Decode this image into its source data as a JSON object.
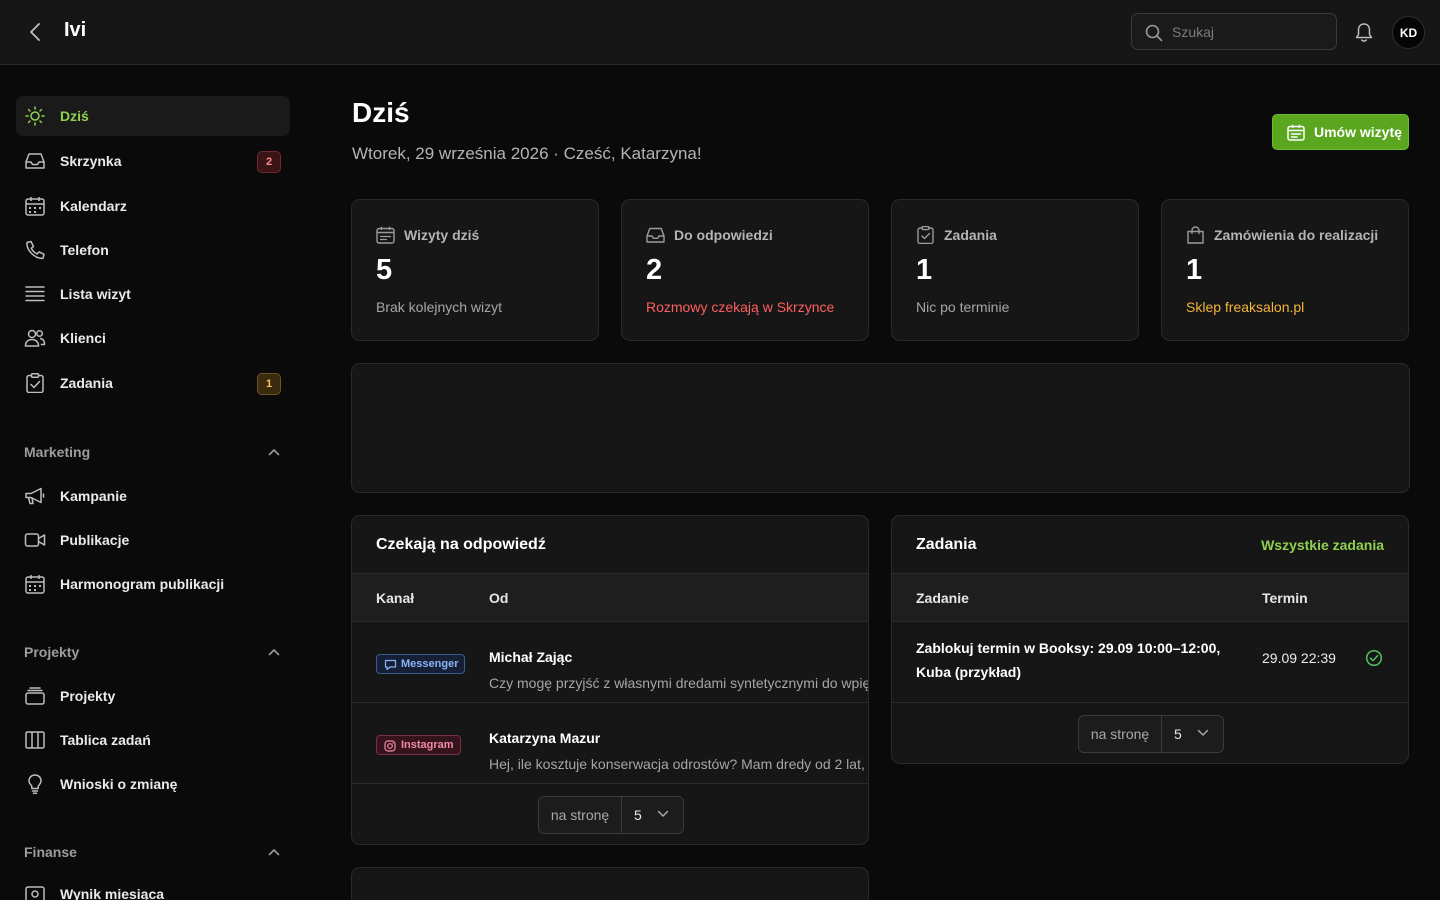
{
  "topbar": {
    "app_title": "Ivi",
    "search_placeholder": "Szukaj",
    "avatar_initials": "KD"
  },
  "sidebar": {
    "main_items": [
      {
        "label": "Dziś",
        "icon": "sun-icon",
        "active": true
      },
      {
        "label": "Skrzynka",
        "icon": "inbox-icon",
        "badge": "2"
      },
      {
        "label": "Kalendarz",
        "icon": "calendar-icon"
      },
      {
        "label": "Telefon",
        "icon": "phone-icon"
      },
      {
        "label": "Lista wizyt",
        "icon": "list-icon"
      },
      {
        "label": "Klienci",
        "icon": "users-icon"
      },
      {
        "label": "Zadania",
        "icon": "clipboard-check-icon",
        "badge": "1"
      }
    ],
    "sections": [
      {
        "label": "Marketing",
        "items": [
          {
            "label": "Kampanie",
            "icon": "megaphone-icon"
          },
          {
            "label": "Publikacje",
            "icon": "video-icon"
          },
          {
            "label": "Harmonogram publikacji",
            "icon": "calendar-icon"
          }
        ]
      },
      {
        "label": "Projekty",
        "items": [
          {
            "label": "Projekty",
            "icon": "folders-icon"
          },
          {
            "label": "Tablica zadań",
            "icon": "kanban-icon"
          },
          {
            "label": "Wnioski o zmianę",
            "icon": "lightbulb-icon"
          }
        ]
      },
      {
        "label": "Finanse",
        "items": [
          {
            "label": "Wynik miesiąca",
            "icon": "wallet-icon"
          }
        ]
      }
    ]
  },
  "header": {
    "title": "Dziś",
    "subtitle": "Wtorek, 29 września 2026 · Cześć, Katarzyna!",
    "primary_button": "Umów wizytę"
  },
  "stats": [
    {
      "label": "Wizyty dziś",
      "value": "5",
      "note": "Brak kolejnych wizyt",
      "icon": "calendar-icon"
    },
    {
      "label": "Do odpowiedzi",
      "value": "2",
      "note": "Rozmowy czekają w Skrzynce",
      "icon": "inbox-icon",
      "note_color": "#ff5f5f"
    },
    {
      "label": "Zadania",
      "value": "1",
      "note": "Nic po terminie",
      "icon": "clipboard-check-icon"
    },
    {
      "label": "Zamówienia do realizacji",
      "value": "1",
      "note": "Sklep freaksalon.pl",
      "icon": "shopping-bag-icon",
      "note_color": "#f5b43a"
    }
  ],
  "awaiting": {
    "title": "Czekają na odpowiedź",
    "columns": [
      "Kanał",
      "Od"
    ],
    "rows": [
      {
        "channel": "Messenger",
        "name": "Michał Zając",
        "text": "Czy mogę przyjść z własnymi dredami syntetycznymi do wpię"
      },
      {
        "channel": "Instagram",
        "name": "Katarzyna Mazur",
        "text": "Hej, ile kosztuje konserwacja odrostów? Mam dredy od 2 lat,"
      }
    ],
    "pager": {
      "label": "na stronę",
      "value": "5"
    }
  },
  "tasks": {
    "title": "Zadania",
    "link": "Wszystkie zadania",
    "columns": [
      "Zadanie",
      "Termin"
    ],
    "rows": [
      {
        "text": "Zablokuj termin w Booksy: 29.09 10:00–12:00, Kuba (przykład)",
        "due": "29.09 22:39"
      }
    ],
    "pager": {
      "label": "na stronę",
      "value": "5"
    }
  },
  "colors": {
    "accent": "#8fd14f",
    "primary_button": "#5aa61f",
    "danger": "#ff5f5f",
    "warning": "#f5b43a",
    "background": "#0a0a0a",
    "card": "#161616"
  }
}
